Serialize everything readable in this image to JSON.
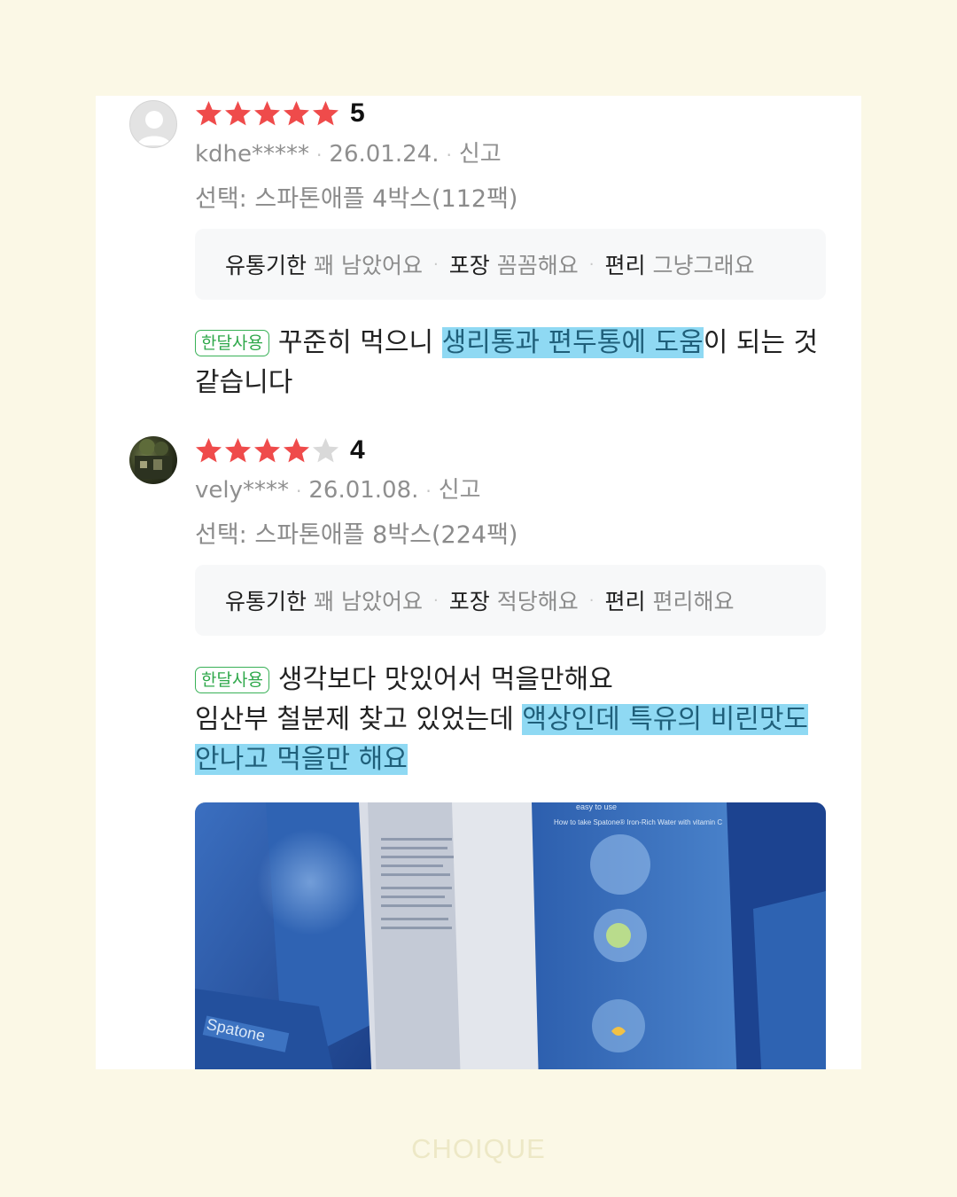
{
  "reviews": [
    {
      "rating": "5",
      "stars_filled": 5,
      "user": "kdhe*****",
      "date": "26.01.24.",
      "report": "신고",
      "option": "선택: 스파톤애플 4박스(112팩)",
      "attrs": [
        {
          "key": "유통기한",
          "value": "꽤 남았어요"
        },
        {
          "key": "포장",
          "value": "꼼꼼해요"
        },
        {
          "key": "편리",
          "value": "그냥그래요"
        }
      ],
      "tag": "한달사용",
      "text_before": "꾸준히 먹으니 ",
      "text_highlight": "생리통과 편두통에 도움",
      "text_after": "이 되는 것 같습니다"
    },
    {
      "rating": "4",
      "stars_filled": 4,
      "user": "vely****",
      "date": "26.01.08.",
      "report": "신고",
      "option": "선택: 스파톤애플 8박스(224팩)",
      "attrs": [
        {
          "key": "유통기한",
          "value": "꽤 남았어요"
        },
        {
          "key": "포장",
          "value": "적당해요"
        },
        {
          "key": "편리",
          "value": "편리해요"
        }
      ],
      "tag": "한달사용",
      "line1": "생각보다 맛있어서 먹을만해요",
      "line2_before": "임산부 철분제 찾고 있었는데 ",
      "line2_highlight": "액상인데 특유의 비린맛도",
      "line3_highlight": "안나고 먹을만 해요"
    }
  ],
  "photo": {
    "product": "Spatone",
    "label_top": "easy to use",
    "label_howto": "How to take Spatone® Iron-Rich Water with vitamin C"
  },
  "watermark": "CHOIQUE",
  "colors": {
    "background": "#fbf8e6",
    "star_filled": "#ef4b4b",
    "star_empty": "#d9d9d9",
    "highlight": "#8fd9f3",
    "tag_green": "#2ea84a"
  }
}
